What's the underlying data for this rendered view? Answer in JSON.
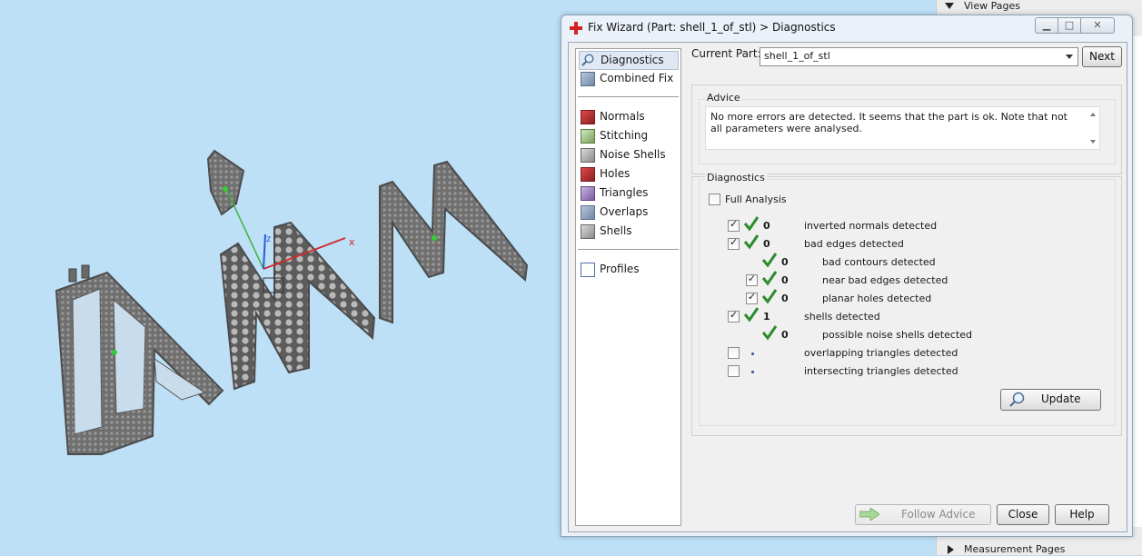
{
  "dialog": {
    "title": "Fix Wizard (Part: shell_1_of_stl) > Diagnostics"
  },
  "right_panel": {
    "header": "View Pages",
    "footer": "Measurement Pages"
  },
  "viewport": {
    "axis_x": "x",
    "axis_z": "z"
  },
  "nav": {
    "items": [
      {
        "label": "Diagnostics",
        "icon": "magnifier-icon"
      },
      {
        "label": "Combined Fix",
        "icon": "combined-fix-icon"
      },
      {
        "label": "Normals",
        "icon": "normals-icon"
      },
      {
        "label": "Stitching",
        "icon": "stitching-icon"
      },
      {
        "label": "Noise Shells",
        "icon": "noise-shells-icon"
      },
      {
        "label": "Holes",
        "icon": "holes-icon"
      },
      {
        "label": "Triangles",
        "icon": "triangles-icon"
      },
      {
        "label": "Overlaps",
        "icon": "overlaps-icon"
      },
      {
        "label": "Shells",
        "icon": "shells-icon"
      },
      {
        "label": "Profiles",
        "icon": "profiles-icon"
      }
    ]
  },
  "current_part": {
    "label": "Current Part:",
    "value": "shell_1_of_stl",
    "next_label": "Next"
  },
  "advice": {
    "title": "Advice",
    "text": "No more errors are detected. It seems that the part is ok. Note that not all parameters were analysed."
  },
  "diagnostics": {
    "title": "Diagnostics",
    "full_analysis_label": "Full Analysis",
    "rows": [
      {
        "count": "0",
        "label": "inverted normals detected",
        "checked": true,
        "status": "ok"
      },
      {
        "count": "0",
        "label": "bad edges detected",
        "checked": true,
        "status": "ok"
      },
      {
        "count": "0",
        "label": "bad contours detected",
        "checked": null,
        "status": "ok"
      },
      {
        "count": "0",
        "label": "near bad edges detected",
        "checked": true,
        "status": "ok"
      },
      {
        "count": "0",
        "label": "planar holes detected",
        "checked": true,
        "status": "ok"
      },
      {
        "count": "1",
        "label": "shells detected",
        "checked": true,
        "status": "ok"
      },
      {
        "count": "0",
        "label": "possible noise shells detected",
        "checked": null,
        "status": "ok"
      },
      {
        "count": "",
        "label": "overlapping triangles detected",
        "checked": false,
        "status": "pending"
      },
      {
        "count": "",
        "label": "intersecting triangles detected",
        "checked": false,
        "status": "pending"
      }
    ],
    "update_label": "Update"
  },
  "footer_buttons": {
    "follow_advice": "Follow Advice",
    "close": "Close",
    "help": "Help"
  },
  "colors": {
    "check_green": "#2e8b2e",
    "viewport_bg": "#bde0f7",
    "axis_red": "#d12b2b",
    "axis_green": "#3cb43c",
    "axis_blue": "#2a5bd7"
  }
}
